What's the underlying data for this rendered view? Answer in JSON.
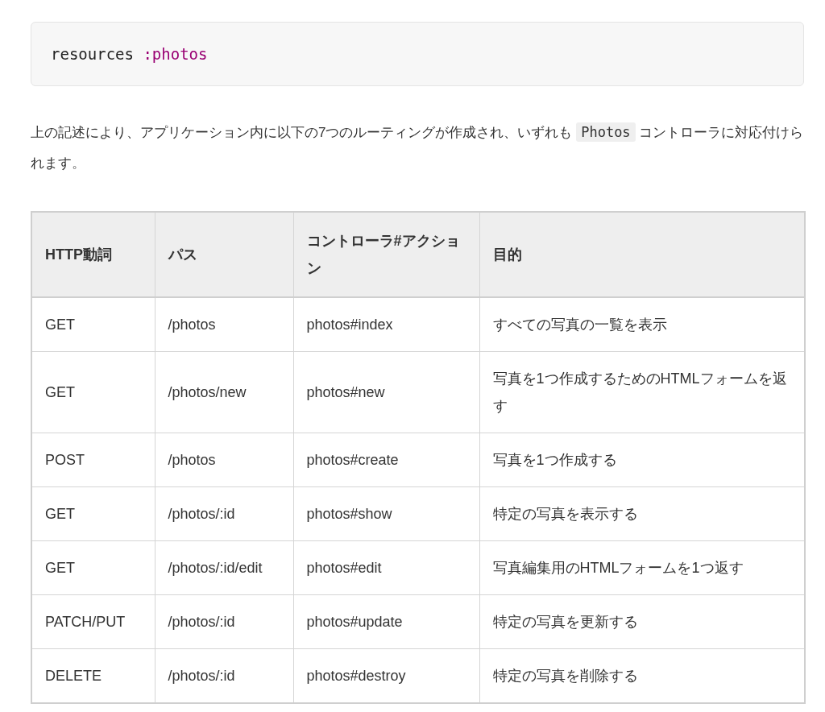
{
  "code_block": {
    "tokens": [
      {
        "text": "resources ",
        "kind": "plain"
      },
      {
        "text": ":photos",
        "kind": "symbol"
      }
    ]
  },
  "paragraph": {
    "parts": [
      {
        "text": "上の記述により、アプリケーション内に以下の7つのルーティングが作成され、いずれも ",
        "kind": "text"
      },
      {
        "text": "Photos",
        "kind": "code"
      },
      {
        "text": " コントローラに対応付けられます。",
        "kind": "text"
      }
    ]
  },
  "table": {
    "columns": [
      "HTTP動詞",
      "パス",
      "コントローラ#アクション",
      "目的"
    ],
    "rows": [
      [
        "GET",
        "/photos",
        "photos#index",
        "すべての写真の一覧を表示"
      ],
      [
        "GET",
        "/photos/new",
        "photos#new",
        "写真を1つ作成するためのHTMLフォームを返す"
      ],
      [
        "POST",
        "/photos",
        "photos#create",
        "写真を1つ作成する"
      ],
      [
        "GET",
        "/photos/:id",
        "photos#show",
        "特定の写真を表示する"
      ],
      [
        "GET",
        "/photos/:id/edit",
        "photos#edit",
        "写真編集用のHTMLフォームを1つ返す"
      ],
      [
        "PATCH/PUT",
        "/photos/:id",
        "photos#update",
        "特定の写真を更新する"
      ],
      [
        "DELETE",
        "/photos/:id",
        "photos#destroy",
        "特定の写真を削除する"
      ]
    ]
  }
}
